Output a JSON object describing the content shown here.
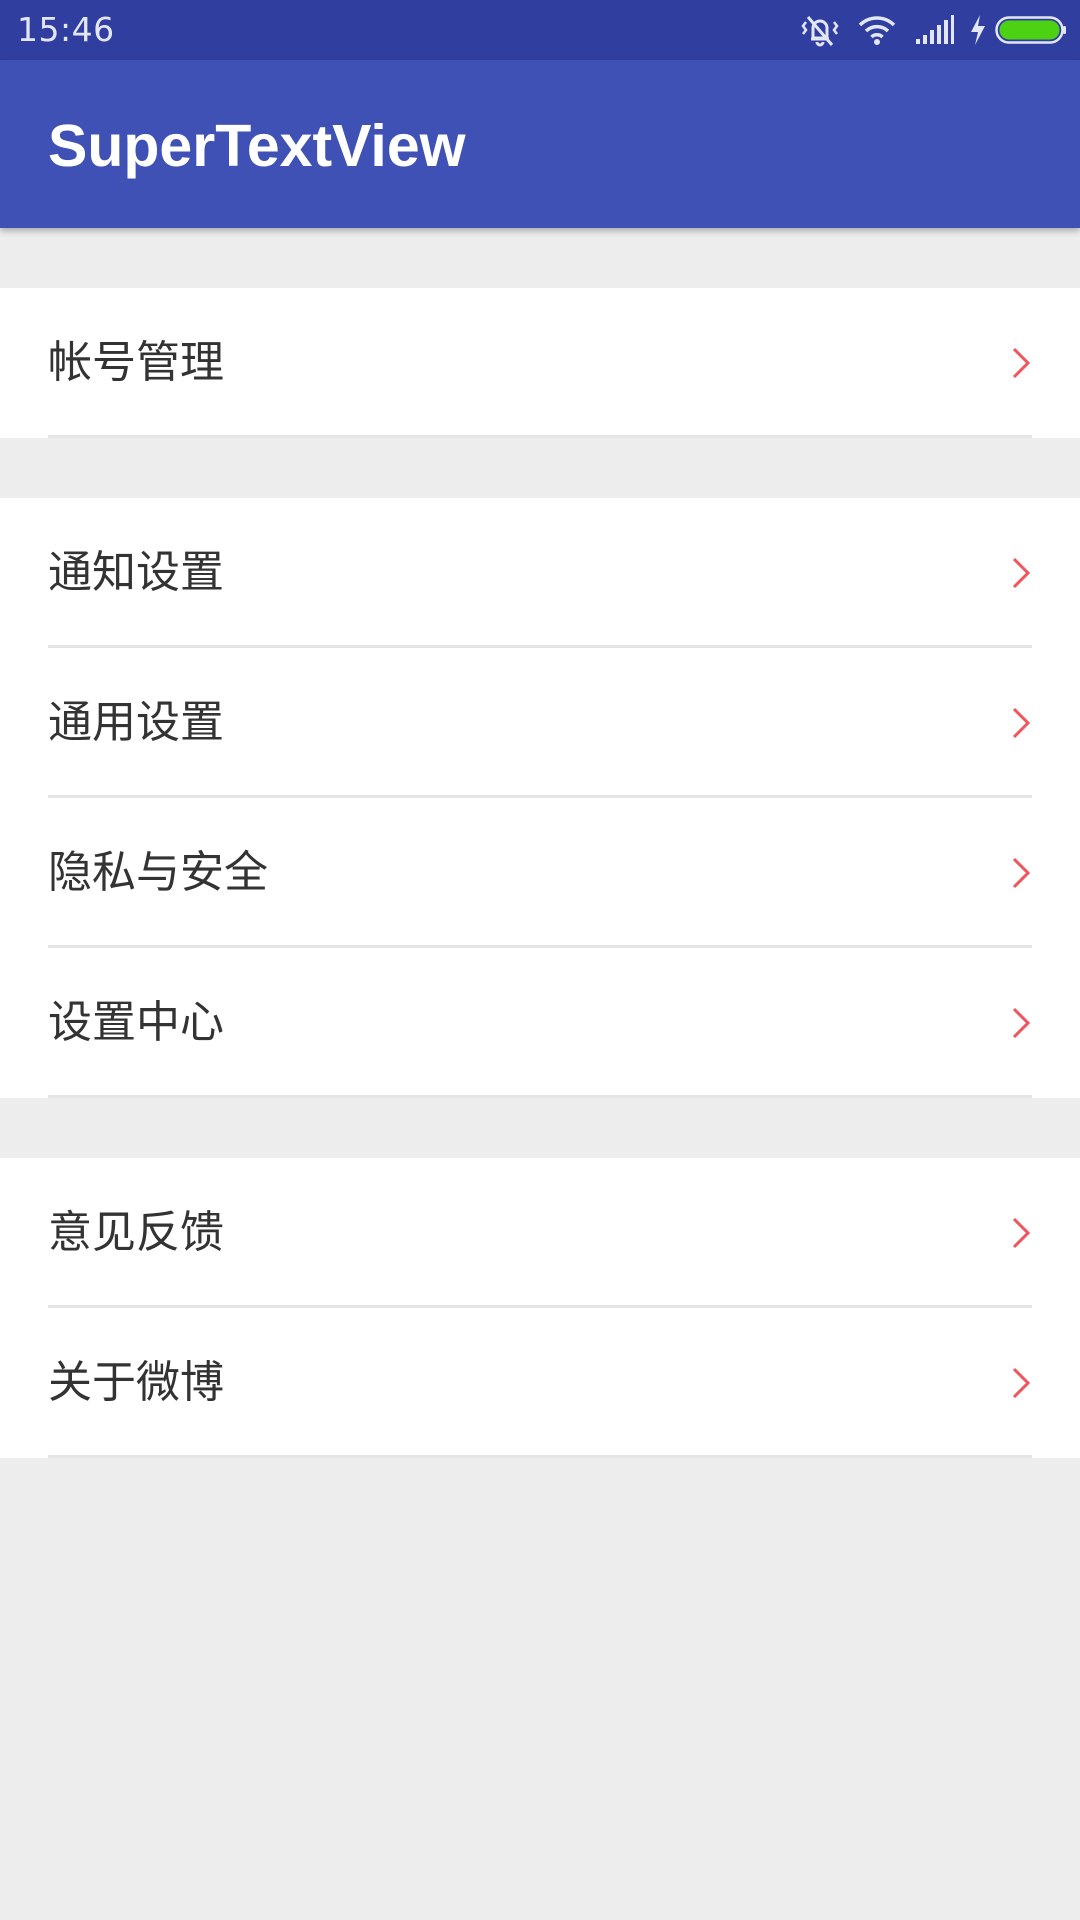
{
  "status_bar": {
    "time": "15:46",
    "icons": [
      "vibrate-icon",
      "wifi-icon",
      "signal-icon",
      "charging-icon",
      "battery-icon"
    ],
    "battery_color": "#4cd213"
  },
  "app_bar": {
    "title": "SuperTextView",
    "color": "#3f51b5"
  },
  "settings": {
    "groups": [
      {
        "items": [
          {
            "label": "帐号管理",
            "icon": "chevron-right-icon"
          }
        ]
      },
      {
        "items": [
          {
            "label": "通知设置",
            "icon": "chevron-right-icon"
          },
          {
            "label": "通用设置",
            "icon": "chevron-right-icon"
          },
          {
            "label": "隐私与安全",
            "icon": "chevron-right-icon"
          },
          {
            "label": "设置中心",
            "icon": "chevron-right-icon"
          }
        ]
      },
      {
        "items": [
          {
            "label": "意见反馈",
            "icon": "chevron-right-icon"
          },
          {
            "label": "关于微博",
            "icon": "chevron-right-icon"
          }
        ]
      }
    ],
    "chevron_color": "#f0555e"
  }
}
